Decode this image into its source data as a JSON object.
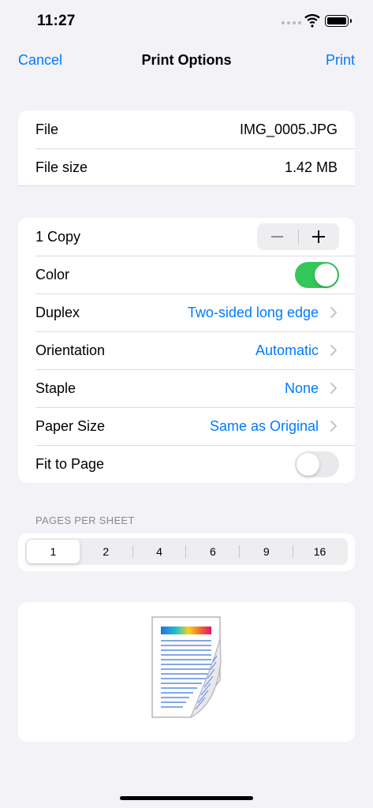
{
  "status_bar": {
    "time": "11:27"
  },
  "nav": {
    "cancel_label": "Cancel",
    "title": "Print Options",
    "print_label": "Print"
  },
  "file_info": {
    "file_label": "File",
    "file_value": "IMG_0005.JPG",
    "size_label": "File size",
    "size_value": "1.42 MB"
  },
  "options": {
    "copies_label": "1 Copy",
    "copies": 1,
    "color_label": "Color",
    "color_on": true,
    "duplex_label": "Duplex",
    "duplex_value": "Two-sided long edge",
    "orientation_label": "Orientation",
    "orientation_value": "Automatic",
    "staple_label": "Staple",
    "staple_value": "None",
    "paper_size_label": "Paper Size",
    "paper_size_value": "Same as Original",
    "fit_to_page_label": "Fit to Page",
    "fit_to_page_on": false
  },
  "pages_per_sheet": {
    "header": "PAGES PER SHEET",
    "options": [
      "1",
      "2",
      "4",
      "6",
      "9",
      "16"
    ],
    "selected": "1"
  },
  "colors": {
    "accent": "#007aff",
    "toggle_on": "#34c759",
    "background": "#f2f2f7"
  },
  "icons": [
    "wifi-icon",
    "battery-icon",
    "minus-icon",
    "plus-icon",
    "chevron-right-icon",
    "document-preview-icon"
  ]
}
